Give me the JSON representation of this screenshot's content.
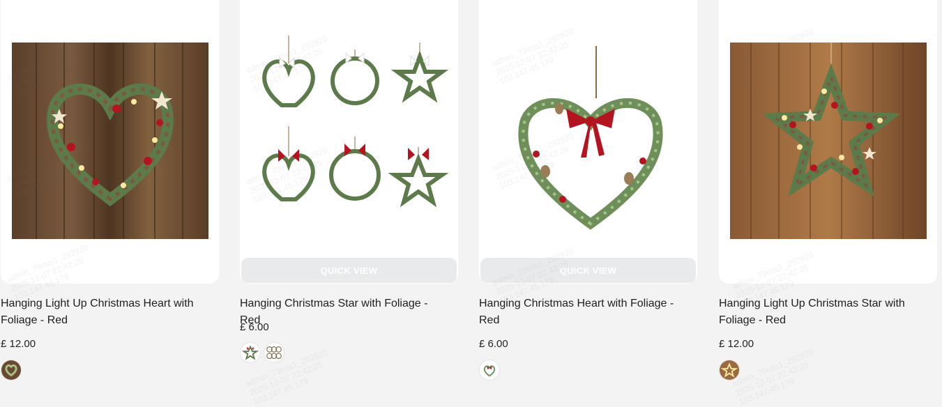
{
  "products": [
    {
      "title": "Hanging Light Up Christmas Heart with Foliage - Red",
      "price": "£ 12.00",
      "image_icon": "heart-wreath-lights-on-wood",
      "swatches": [
        "heart-wreath-wood-swatch"
      ]
    },
    {
      "title": "Hanging Christmas Star with Foliage - Red",
      "price": "£ 6.00",
      "image_icon": "wreath-set-six-shapes",
      "quick_view": "QUICK VIEW",
      "swatches": [
        "star-wreath-swatch",
        "wreath-set-swatch"
      ]
    },
    {
      "title": "Hanging Christmas Heart with Foliage - Red",
      "price": "£ 6.00",
      "image_icon": "heart-wreath-red-bow",
      "quick_view": "QUICK VIEW",
      "swatches": [
        "heart-wreath-swatch"
      ]
    },
    {
      "title": "Hanging Light Up Christmas Star with Foliage - Red",
      "price": "£ 12.00",
      "image_icon": "star-wreath-lights-on-wood",
      "swatches": [
        "star-wreath-wood-swatch"
      ]
    }
  ],
  "watermark": "admin_79mis1_292920\n2025-12-07 22:42:25\n103.147.45.179",
  "colors": {
    "page_bg": "#f3f3f3",
    "card_bg": "#ffffff",
    "wood": "#6b4a32",
    "foliage": "#5d7a4a",
    "berry_red": "#b3141f"
  }
}
